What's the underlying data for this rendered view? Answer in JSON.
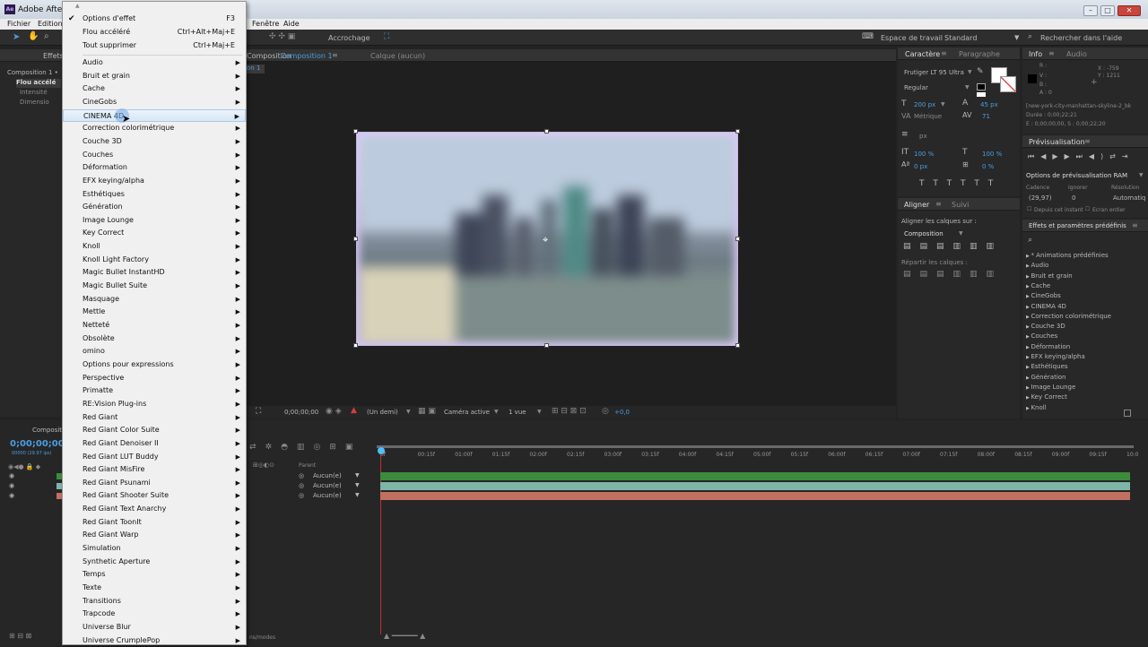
{
  "window": {
    "title": "Adobe After E",
    "buttons": [
      "–",
      "□",
      "✕"
    ]
  },
  "menubar": {
    "items": [
      "Fichier",
      "Edition",
      "Fenêtre",
      "Aide"
    ]
  },
  "toolbar": {
    "snap": "Accrochage",
    "workspace_label": "Espace de travail :",
    "workspace_value": "Standard",
    "search_placeholder": "Rechercher dans l'aide"
  },
  "left_panel": {
    "tabs": [
      "Composition 1 •",
      "Effets"
    ],
    "effect": "Flou accélé",
    "props": [
      "Intensité",
      "Dimensio"
    ]
  },
  "comp_panel": {
    "tab": "Composition",
    "name": "Composition 1",
    "layer_label": "Calque  (aucun)",
    "sub_tab": "on 1",
    "timecode": "0;00;00;00",
    "resolution": "(Un demi)",
    "camera": "Caméra active",
    "views": "1 vue",
    "offset": "+0,0"
  },
  "context_menu": {
    "top": [
      {
        "label": "Options d'effet",
        "shortcut": "F3",
        "checked": true
      },
      {
        "label": "Flou accéléré",
        "shortcut": "Ctrl+Alt+Maj+E"
      },
      {
        "label": "Tout supprimer",
        "shortcut": "Ctrl+Maj+E"
      }
    ],
    "items": [
      "Audio",
      "Bruit et grain",
      "Cache",
      "CineGobs",
      "CINEMA 4D",
      "Correction colorimétrique",
      "Couche 3D",
      "Couches",
      "Déformation",
      "EFX keying/alpha",
      "Esthétiques",
      "Génération",
      "Image Lounge",
      "Key Correct",
      "Knoll",
      "Knoll Light Factory",
      "Magic Bullet InstantHD",
      "Magic Bullet Suite",
      "Masquage",
      "Mettle",
      "Netteté",
      "Obsolète",
      "omino",
      "Options pour expressions",
      "Perspective",
      "Primatte",
      "RE:Vision Plug-ins",
      "Red Giant",
      "Red Giant Color Suite",
      "Red Giant Denoiser II",
      "Red Giant LUT Buddy",
      "Red Giant MisFire",
      "Red Giant Psunami",
      "Red Giant Shooter Suite",
      "Red Giant Text Anarchy",
      "Red Giant ToonIt",
      "Red Giant Warp",
      "Simulation",
      "Synthetic Aperture",
      "Temps",
      "Texte",
      "Transitions",
      "Trapcode",
      "Universe Blur",
      "Universe CrumplePop"
    ],
    "highlighted": "CINEMA 4D"
  },
  "character": {
    "tabs": [
      "Caractère",
      "Paragraphe"
    ],
    "font": "Frutiger LT 95 Ultra",
    "style": "Regular",
    "size": "200 px",
    "leading": "45 px",
    "kerning": "Métrique",
    "tracking": "71",
    "unit": "px",
    "vscale": "100 %",
    "hscale": "100 %",
    "baseline": "0 px",
    "tsume": "0 %",
    "format_buttons": [
      "T",
      "T",
      "TT",
      "Tt",
      "T",
      "T,"
    ]
  },
  "align": {
    "tabs": [
      "Aligner",
      "Suivi"
    ],
    "align_to_label": "Aligner les calques sur :",
    "align_to": "Composition",
    "distribute_label": "Répartir les calques :"
  },
  "info": {
    "tabs": [
      "Info",
      "Audio"
    ],
    "rgba": [
      "R :",
      "V :",
      "B :",
      "A : 0"
    ],
    "x": "X : -759",
    "y": "Y : 1211",
    "file": "[new-york-city-manhattan-skyline-2_bk",
    "duration": "Durée : 0;00;22;21",
    "range": "E : 0;00;00;00, S : 0;00;22;20"
  },
  "preview": {
    "title": "Prévisualisation",
    "ram_options": "Options de prévisualisation RAM",
    "cadence_label": "Cadence",
    "ignore_label": "Ignorer",
    "resolution_label": "Résolution",
    "cadence": "(29,97)",
    "ignore": "0",
    "resolution": "Automatiq",
    "from_now": "Depuis cet instant",
    "fullscreen": "Ecran entier"
  },
  "effects_presets": {
    "title": "Effets et paramètres prédéfinis",
    "items": [
      "* Animations prédéfinies",
      "Audio",
      "Bruit et grain",
      "Cache",
      "CineGobs",
      "CINEMA 4D",
      "Correction colorimétrique",
      "Couche 3D",
      "Couches",
      "Déformation",
      "EFX keying/alpha",
      "Esthétiques",
      "Génération",
      "Image Lounge",
      "Key Correct",
      "Knoll"
    ]
  },
  "timeline": {
    "tab": "Composit",
    "timecode": "0;00;00;00",
    "fps": "00000 (29.97 ips)",
    "parent_label": "Parent",
    "parents": [
      "Aucun(e)",
      "Aucun(e)",
      "Aucun(e)"
    ],
    "ticks": [
      "0f",
      "00:15f",
      "01:00f",
      "01:15f",
      "02:00f",
      "02:15f",
      "03:00f",
      "03:15f",
      "04:00f",
      "04:15f",
      "05:00f",
      "05:15f",
      "06:00f",
      "06:15f",
      "07:00f",
      "07:15f",
      "08:00f",
      "08:15f",
      "09:00f",
      "09:15f",
      "10:0"
    ],
    "footer": "ns/modes",
    "layer_colors": [
      "#3c8c3c",
      "#7fb4a8",
      "#c07060"
    ]
  }
}
